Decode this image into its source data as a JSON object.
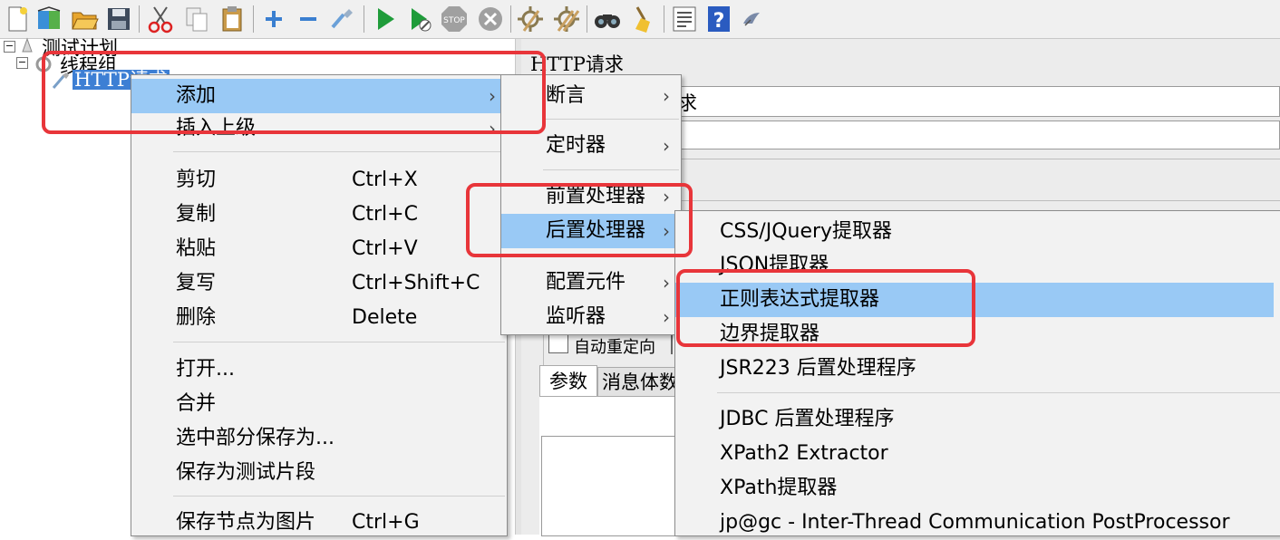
{
  "tree": {
    "test_plan": "测试计划",
    "thread_group": "线程组",
    "http_request": "HTTP请求",
    "expand_sign": "−"
  },
  "right_panel": {
    "title": "HTTP请求",
    "name_tail": "求",
    "auto_redirect": "自动重定向",
    "tab_params": "参数",
    "tab_body": "消息体数"
  },
  "context_menu": {
    "items": [
      {
        "label": "添加",
        "arrow": "›"
      },
      {
        "label": "插入上级",
        "arrow": "›"
      },
      {
        "label": "剪切",
        "shortcut": "Ctrl+X"
      },
      {
        "label": "复制",
        "shortcut": "Ctrl+C"
      },
      {
        "label": "粘贴",
        "shortcut": "Ctrl+V"
      },
      {
        "label": "复写",
        "shortcut": "Ctrl+Shift+C"
      },
      {
        "label": "删除",
        "shortcut": "Delete"
      },
      {
        "label": "打开..."
      },
      {
        "label": "合并"
      },
      {
        "label": "选中部分保存为..."
      },
      {
        "label": "保存为测试片段"
      },
      {
        "label": "保存节点为图片",
        "shortcut": "Ctrl+G"
      }
    ]
  },
  "add_submenu": {
    "items": [
      {
        "label": "断言",
        "arrow": "›"
      },
      {
        "label": "定时器",
        "arrow": "›"
      },
      {
        "label": "前置处理器",
        "arrow": "›"
      },
      {
        "label": "后置处理器",
        "arrow": "›"
      },
      {
        "label": "配置元件",
        "arrow": "›"
      },
      {
        "label": "监听器",
        "arrow": "›"
      }
    ]
  },
  "post_processor_submenu": {
    "items": [
      {
        "label": "CSS/JQuery提取器"
      },
      {
        "label": "JSON提取器"
      },
      {
        "label": "正则表达式提取器"
      },
      {
        "label": "边界提取器"
      },
      {
        "label": "JSR223 后置处理程序"
      },
      {
        "label": "JDBC 后置处理程序"
      },
      {
        "label": "XPath2 Extractor"
      },
      {
        "label": "XPath提取器"
      },
      {
        "label": "jp@gc - Inter-Thread Communication PostProcessor"
      }
    ]
  },
  "colors": {
    "highlight": "#99c9f5",
    "annotation_red": "#e8353a",
    "menu_bg": "#f2f2f2"
  },
  "toolbar_icons": [
    "new-icon",
    "templates-icon",
    "open-icon",
    "save-icon",
    "cut-icon",
    "copy-icon",
    "paste-icon",
    "expand-icon",
    "collapse-icon",
    "toggle-icon",
    "start-icon",
    "start-no-pause-icon",
    "stop-icon",
    "shutdown-icon",
    "clear-icon",
    "clear-all-icon",
    "search-icon",
    "reset-search-icon",
    "function-helper-icon",
    "help-icon",
    "logger-icon"
  ]
}
